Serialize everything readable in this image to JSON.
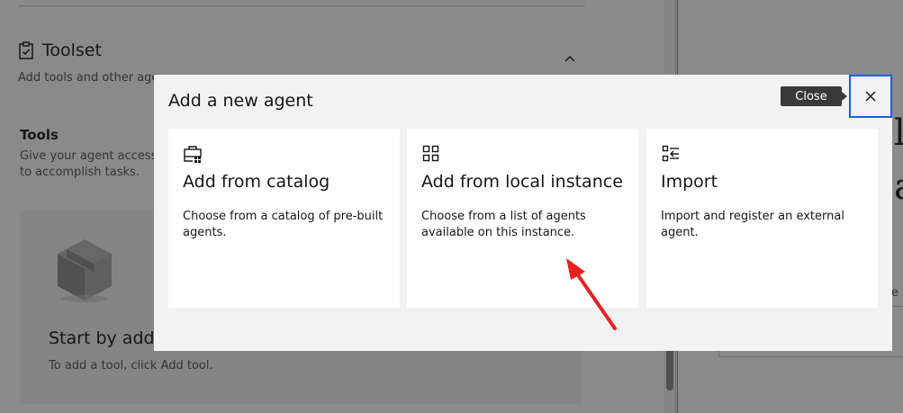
{
  "background": {
    "toolset": {
      "title": "Toolset",
      "description": "Add tools and other age                                        ",
      "icon": "clipboard-icon"
    },
    "tools": {
      "title": "Tools",
      "description": "Give your agent access to accomplish tasks."
    },
    "empty_state": {
      "title": "Start by addin",
      "description": "To add a tool, click Add tool.",
      "icon": "box-icon"
    },
    "right_panel": {
      "char_1": "l",
      "char_2": "a",
      "small_text": "e"
    }
  },
  "modal": {
    "title": "Add a new agent",
    "close_tooltip": "Close",
    "close_icon": "close-icon",
    "tiles": [
      {
        "icon": "catalog-icon",
        "title": "Add from catalog",
        "description": "Choose from a catalog of pre-built agents."
      },
      {
        "icon": "grid-icon",
        "title": "Add from local instance",
        "description": "Choose from a list of agents available on this instance."
      },
      {
        "icon": "import-list-icon",
        "title": "Import",
        "description": "Import and register an external agent."
      }
    ]
  },
  "colors": {
    "focus": "#0f62fe",
    "overlay": "rgba(22,22,22,0.5)",
    "annotation_arrow": "#e8201e",
    "tooltip": "#393939"
  }
}
